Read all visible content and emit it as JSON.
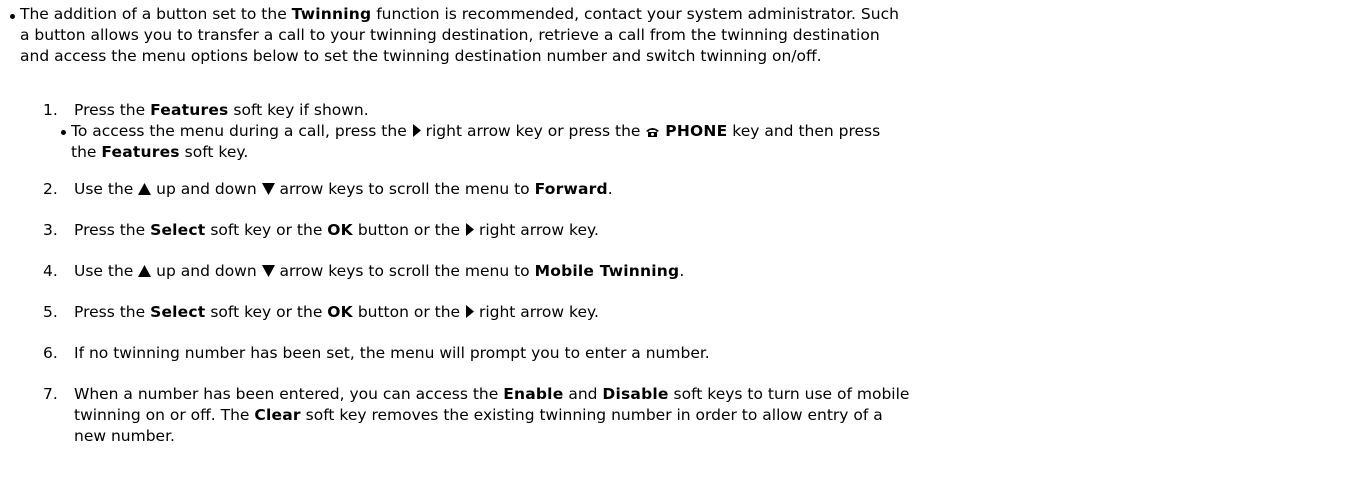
{
  "intro": {
    "text_a": "The addition of a button set to the ",
    "bold_a": "Twinning",
    "text_b": " function is recommended, contact your system administrator. Such",
    "line2": "a button allows you to transfer a call to your twinning destination, retrieve a call from the twinning destination",
    "line3": "and access the menu options below to set the twinning destination number and switch twinning on/off."
  },
  "steps": [
    {
      "num": "1.",
      "a": "Press the ",
      "b1": "Features",
      "c": " soft key if shown."
    },
    {
      "num": "2.",
      "a": "Use the ",
      "b": " up and down ",
      "c": " arrow keys to scroll the menu to ",
      "b1": "Forward",
      "d": "."
    },
    {
      "num": "3.",
      "a": "Press the ",
      "b1": "Select",
      "c": " soft key or the ",
      "b2": "OK",
      "d": " button or the ",
      "e": " right arrow key."
    },
    {
      "num": "4.",
      "a": "Use the ",
      "b": " up and down ",
      "c": " arrow keys to scroll the menu to ",
      "b1": "Mobile Twinning",
      "d": "."
    },
    {
      "num": "5.",
      "a": "Press the ",
      "b1": "Select",
      "c": " soft key or the ",
      "b2": "OK",
      "d": " button or the ",
      "e": " right arrow key."
    },
    {
      "num": "6.",
      "a": "If no twinning number has been set, the menu will prompt you to enter a number."
    },
    {
      "num": "7.",
      "a": "When a number has been entered, you can access the ",
      "b1": "Enable",
      "c": " and ",
      "b2": "Disable",
      "d": " soft keys to turn use of mobile",
      "line2": "twinning on or off. The ",
      "b3": "Clear",
      "e": " soft key removes the existing twinning number in order to allow entry of a",
      "line3": "new number."
    }
  ],
  "sub_step": {
    "a": "To access the menu during a call, press the ",
    "b": " right arrow key or press the ",
    "b1": "PHONE",
    "c": " key and then press",
    "line2_a": "the ",
    "b2": "Features",
    "line2_b": " soft key."
  },
  "icons": {
    "right_arrow": "right-arrow-key-icon",
    "up_arrow": "up-arrow-key-icon",
    "down_arrow": "down-arrow-key-icon",
    "phone": "phone-key-icon"
  }
}
